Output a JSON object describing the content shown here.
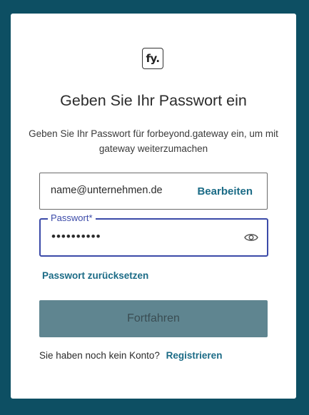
{
  "logo": {
    "text": "fy."
  },
  "title": "Geben Sie Ihr Passwort ein",
  "subtitle": "Geben Sie Ihr Passwort für forbeyond.gateway ein, um mit gateway weiterzumachen",
  "email": {
    "value": "name@unternehmen.de",
    "edit_label": "Bearbeiten"
  },
  "password": {
    "label": "Passwort*",
    "value": "••••••••••",
    "toggle_icon": "eye-icon"
  },
  "reset_link": "Passwort zurücksetzen",
  "continue_button": "Fortfahren",
  "signup": {
    "prompt": "Sie haben noch kein Konto?",
    "link": "Registrieren"
  },
  "colors": {
    "background": "#0d4f63",
    "accent": "#1b6b86",
    "focus": "#3b4aa8",
    "button": "#5f8590"
  }
}
